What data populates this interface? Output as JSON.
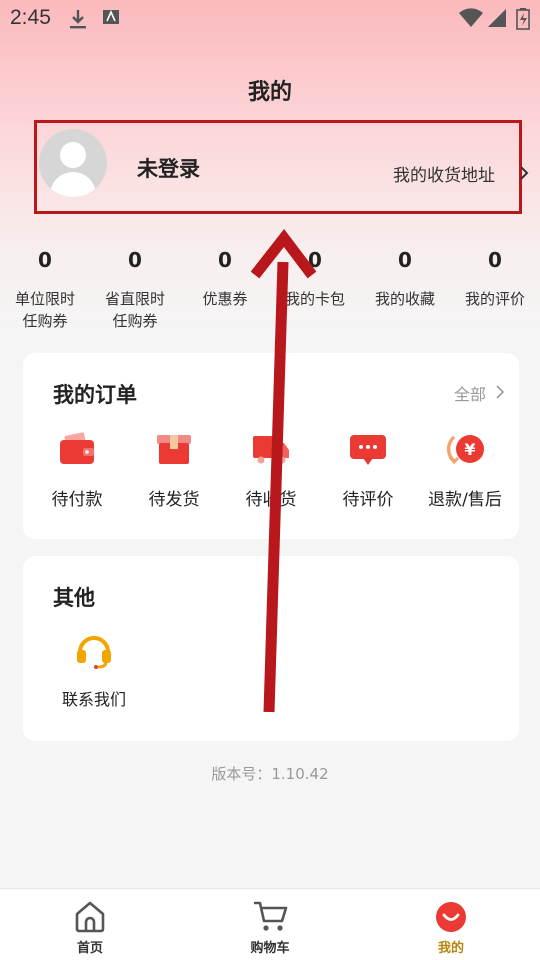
{
  "status_bar": {
    "time": "2:45"
  },
  "header": {
    "title": "我的"
  },
  "profile": {
    "login_text": "未登录",
    "address_label": "我的收货地址"
  },
  "stats": [
    {
      "value": "0",
      "label1": "单位限时",
      "label2": "任购券"
    },
    {
      "value": "0",
      "label1": "省直限时",
      "label2": "任购券"
    },
    {
      "value": "0",
      "label1": "优惠券",
      "label2": ""
    },
    {
      "value": "0",
      "label1": "我的卡包",
      "label2": ""
    },
    {
      "value": "0",
      "label1": "我的收藏",
      "label2": ""
    },
    {
      "value": "0",
      "label1": "我的评价",
      "label2": ""
    }
  ],
  "orders": {
    "title": "我的订单",
    "all_label": "全部",
    "items": [
      {
        "label": "待付款",
        "icon": "wallet-icon"
      },
      {
        "label": "待发货",
        "icon": "box-icon"
      },
      {
        "label": "待收货",
        "icon": "truck-icon"
      },
      {
        "label": "待评价",
        "icon": "chat-icon"
      },
      {
        "label": "退款/售后",
        "icon": "refund-icon"
      }
    ]
  },
  "others": {
    "title": "其他",
    "contact_label": "联系我们"
  },
  "version": "版本号：1.10.42",
  "tabbar": [
    {
      "label": "首页",
      "icon": "home-icon"
    },
    {
      "label": "购物车",
      "icon": "cart-icon"
    },
    {
      "label": "我的",
      "icon": "profile-icon"
    }
  ],
  "colors": {
    "accent": "#e8322c",
    "annotation": "#b8181c",
    "active_tab": "#b8860b"
  }
}
